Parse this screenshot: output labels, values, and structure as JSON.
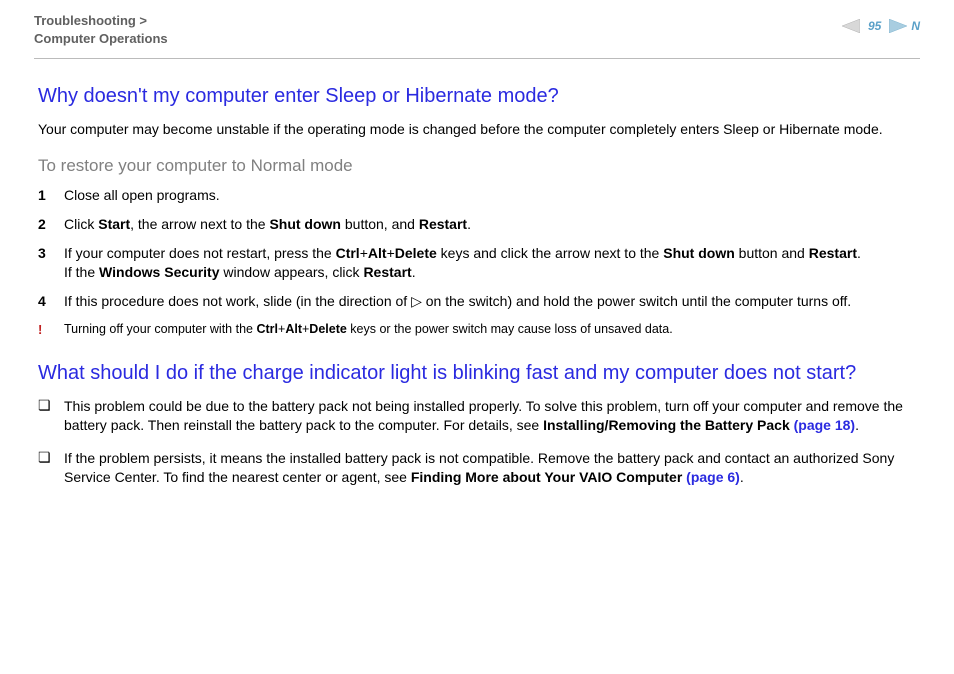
{
  "header": {
    "breadcrumb_top": "Troubleshooting >",
    "breadcrumb_bottom": "Computer Operations",
    "page_number": "95",
    "n_label": "N"
  },
  "q1": {
    "title": "Why doesn't my computer enter Sleep or Hibernate mode?",
    "intro": "Your computer may become unstable if the operating mode is changed before the computer completely enters Sleep or Hibernate mode.",
    "sub": "To restore your computer to Normal mode",
    "steps": {
      "s1": "Close all open programs.",
      "s2_a": "Click ",
      "s2_b_start": "Start",
      "s2_c": ", the arrow next to the ",
      "s2_b_shut": "Shut down",
      "s2_d": " button, and ",
      "s2_b_restart": "Restart",
      "s2_e": ".",
      "s3_a": "If your computer does not restart, press the ",
      "s3_b_ctrl": "Ctrl",
      "s3_plus1": "+",
      "s3_b_alt": "Alt",
      "s3_plus2": "+",
      "s3_b_del": "Delete",
      "s3_c": " keys and click the arrow next to the ",
      "s3_b_shut": "Shut down",
      "s3_d": " button and ",
      "s3_b_restart": "Restart",
      "s3_e": ".",
      "s3_line2a": "If the ",
      "s3_b_ws": "Windows Security",
      "s3_line2b": " window appears, click ",
      "s3_b_restart2": "Restart",
      "s3_line2c": ".",
      "s4_a": "If this procedure does not work, slide (in the direction of ",
      "s4_tri": "▷",
      "s4_b": " on the switch) and hold the power switch until the computer turns off."
    },
    "warn": {
      "bang": "!",
      "a": "Turning off your computer with the ",
      "b_ctrl": "Ctrl",
      "p1": "+",
      "b_alt": "Alt",
      "p2": "+",
      "b_del": "Delete",
      "c": " keys or the power switch may cause loss of unsaved data."
    }
  },
  "q2": {
    "title": "What should I do if the charge indicator light is blinking fast and my computer does not start?",
    "b1_a": "This problem could be due to the battery pack not being installed properly. To solve this problem, turn off your computer and remove the battery pack. Then reinstall the battery pack to the computer. For details, see ",
    "b1_b": "Installing/Removing the Battery Pack ",
    "b1_link": "(page 18)",
    "b1_c": ".",
    "b2_a": "If the problem persists, it means the installed battery pack is not compatible. Remove the battery pack and contact an authorized Sony Service Center. To find the nearest center or agent, see ",
    "b2_b": "Finding More about Your VAIO Computer ",
    "b2_link": "(page 6)",
    "b2_c": "."
  },
  "glyphs": {
    "square": "❏"
  }
}
